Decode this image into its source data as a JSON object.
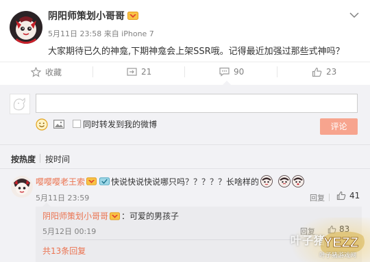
{
  "post": {
    "author": "阴阳师策划小哥哥",
    "meta": "5月11日 23:58 来自 iPhone 7",
    "text": "大家期待已久的神龛,下期神龛会上架SSR哦。记得最近加强过那些式神吗？"
  },
  "actions": {
    "favorite_label": "收藏",
    "repost_count": "21",
    "comment_count": "90",
    "like_count": "23"
  },
  "composer": {
    "input_value": "",
    "repost_label": "同时转发到我的微博",
    "submit_label": "评论"
  },
  "sort": {
    "hot_label": "按热度",
    "time_label": "按时间"
  },
  "comment": {
    "author": "嘤嘤嘤老王索",
    "text": "快说快说快说哪只吗？？？？？长啥样的",
    "time": "5月11日 23:59",
    "reply_label": "回复",
    "like_count": "41"
  },
  "reply": {
    "author": "阴阳师策划小哥哥",
    "text": "：可爱的男孩子",
    "time": "5月12日 00:19",
    "reply_label": "回复",
    "like_count": "83"
  },
  "more_replies": "共13条回复",
  "watermark": {
    "text": "叶子猪",
    "logo_text": "YEZZ",
    "sub_text": "叶子猪游戏网"
  },
  "colors": {
    "accent": "#eb7350",
    "submit_bg": "#f7a48e",
    "panel_bg": "#f2f2f5",
    "nested_bg": "#ebebee"
  }
}
